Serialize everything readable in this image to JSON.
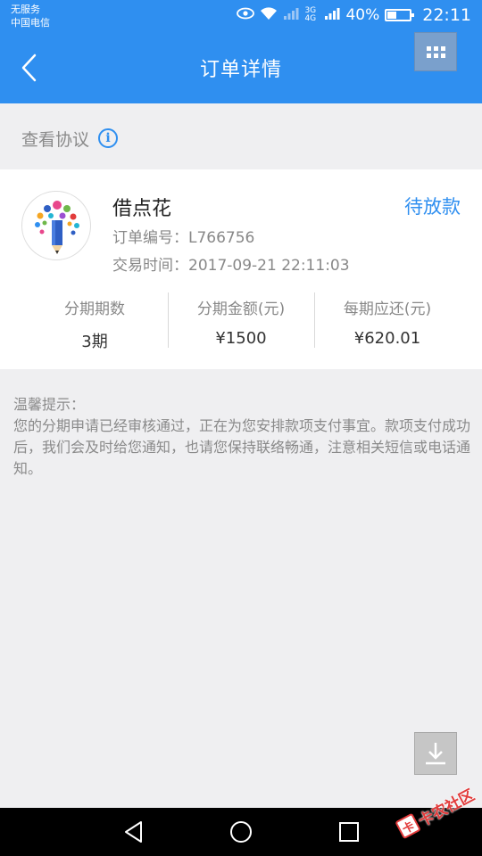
{
  "status_bar": {
    "carrier_line1": "无服务",
    "carrier_line2": "中国电信",
    "network_label": "3G 4G",
    "battery": "40%",
    "battery_level": 0.4,
    "time": "22:11"
  },
  "header": {
    "title": "订单详情",
    "back_icon": "chevron-left-icon",
    "menu_icon": "grid-icon"
  },
  "agreement": {
    "label": "查看协议",
    "icon": "info-icon"
  },
  "order": {
    "product_name": "借点花",
    "status": "待放款",
    "order_number_label": "订单编号：",
    "order_number": "L766756",
    "trade_time_label": "交易时间：",
    "trade_time": "2017-09-21 22:11:03",
    "stats": [
      {
        "label": "分期期数",
        "value": "3期"
      },
      {
        "label": "分期金额(元)",
        "value": "¥1500"
      },
      {
        "label": "每期应还(元)",
        "value": "¥620.01"
      }
    ]
  },
  "notice": {
    "title": "温馨提示：",
    "body": "您的分期申请已经审核通过，正在为您安排款项支付事宜。款项支付成功后，我们会及时给您通知，也请您保持联络畅通，注意相关短信或电话通知。"
  },
  "watermark": {
    "stamp": "卡",
    "text": "卡农社区"
  },
  "colors": {
    "primary": "#2f8ff0",
    "background": "#efeff1",
    "muted_text": "#8a8a8a"
  }
}
